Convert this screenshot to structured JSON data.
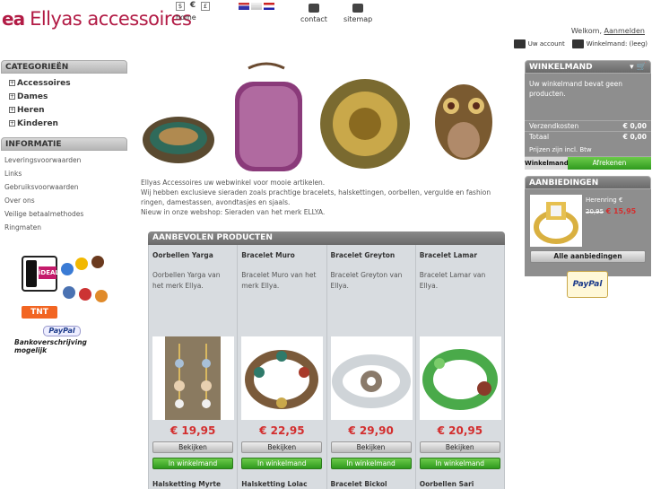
{
  "header": {
    "logo_mark": "ea",
    "logo_name": "Ellyas accessoires",
    "currency": [
      "$",
      "€",
      "£"
    ],
    "currency_active": "€",
    "home_label": "home",
    "links": [
      {
        "label": "contact",
        "icon": "mail-icon"
      },
      {
        "label": "sitemap",
        "icon": "sitemap-icon"
      }
    ],
    "welcome_text": "Welkom, ",
    "login_label": "Aanmelden",
    "account_label": "Uw account",
    "cart_label": "Winkelmand: (leeg)"
  },
  "categories": {
    "title": "CATEGORIEËN",
    "items": [
      "Accessoires",
      "Dames",
      "Heren",
      "Kinderen"
    ]
  },
  "information": {
    "title": "INFORMATIE",
    "items": [
      "Leveringsvoorwaarden",
      "Links",
      "Gebruiksvoorwaarden",
      "Over ons",
      "Veilige betaalmethodes",
      "Ringmaten"
    ]
  },
  "payment": {
    "ideal": "iDEAL",
    "tnt": "TNT",
    "paypal_small": "PayPal",
    "bank_text": "Bankoverschrijving mogelijk"
  },
  "intro": [
    "Ellyas Accessoires uw webwinkel voor mooie artikelen.",
    "Wij hebben exclusieve sieraden zoals prachtige bracelets, halskettingen, oorbellen, vergulde en fashion ringen, damestassen, avondtasjes en sjaals.",
    "Nieuw in onze webshop: Sieraden van het merk ELLYA."
  ],
  "products": {
    "title": "AANBEVOLEN PRODUCTEN",
    "view_label": "Bekijken",
    "cart_label": "In winkelmand",
    "items": [
      {
        "name": "Oorbellen Yarga",
        "desc": "Oorbellen Yarga van het merk Ellya.",
        "price": "€ 19,95"
      },
      {
        "name": "Bracelet Muro",
        "desc": "Bracelet Muro van het merk Ellya.",
        "price": "€ 22,95"
      },
      {
        "name": "Bracelet Greyton",
        "desc": "Bracelet Greyton van Ellya.",
        "price": "€ 29,90"
      },
      {
        "name": "Bracelet Lamar",
        "desc": "Bracelet Lamar van Ellya.",
        "price": "€ 20,95"
      }
    ],
    "next_row": [
      "Halsketting Myrte",
      "Halsketting Lolac",
      "Bracelet Bickol",
      "Oorbellen Sari"
    ]
  },
  "cart": {
    "title": "WINKELMAND",
    "empty_msg": "Uw winkelmand bevat geen producten.",
    "shipping_label": "Verzendkosten",
    "shipping_value": "€ 0,00",
    "total_label": "Totaal",
    "total_value": "€ 0,00",
    "vat_note": "Prijzen zijn incl. Btw",
    "cart_button": "Winkelmand",
    "checkout_button": "Afrekenen"
  },
  "offers": {
    "title": "AANBIEDINGEN",
    "name": "Herenring €",
    "old_price": "20,95",
    "new_price": "€ 15,95",
    "all_button": "Alle aanbiedingen"
  },
  "paypal_badge": "PayPal",
  "colors": {
    "brand": "#b21b45",
    "price": "#d32e2e",
    "green": "#3aa82a"
  }
}
